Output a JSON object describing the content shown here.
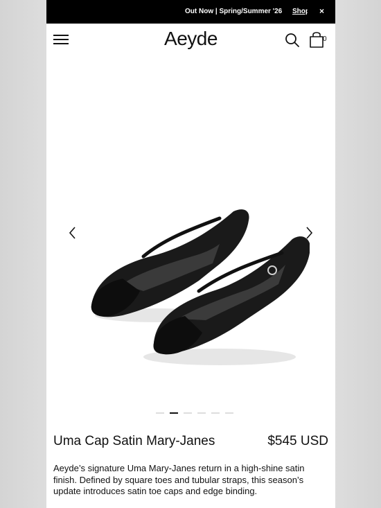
{
  "announcement": {
    "text": "Out Now | Spring/Summer '26",
    "link": "Shop",
    "close": "×"
  },
  "header": {
    "logo": "Aeyde",
    "cart_count": "0"
  },
  "gallery": {
    "total_slides": 6,
    "active_slide": 2
  },
  "product": {
    "title": "Uma Cap Satin Mary-Janes",
    "price": "$545 USD",
    "description": "Aeyde’s signature Uma Mary-Janes return in a high-shine satin finish. Defined by square toes and tubular straps, this season’s update introduces satin toe caps and edge binding."
  },
  "icons": {
    "menu": "hamburger-icon",
    "search": "search-icon",
    "cart": "shopping-bag-icon",
    "prev": "chevron-left-icon",
    "next": "chevron-right-icon",
    "close": "close-icon"
  }
}
